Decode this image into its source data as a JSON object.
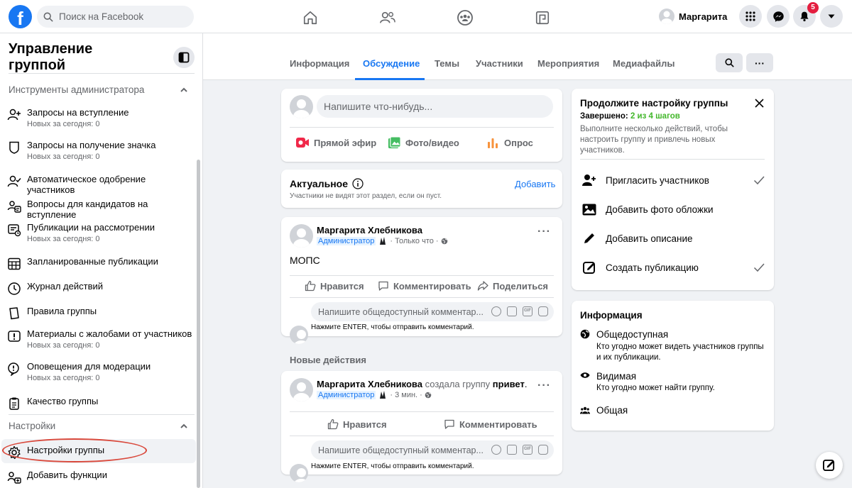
{
  "topbar": {
    "search_placeholder": "Поиск на Facebook",
    "user_name": "Маргарита",
    "notifications_count": "5"
  },
  "sidebar": {
    "title": "Управление группой",
    "admin_tools_label": "Инструменты администратора",
    "items": [
      {
        "label": "Запросы на вступление",
        "sub": "Новых за сегодня: 0",
        "icon": "user-plus-icon"
      },
      {
        "label": "Запросы на получение значка",
        "sub": "Новых за сегодня: 0",
        "icon": "badge-shield-icon"
      },
      {
        "label": "Автоматическое одобрение участников",
        "sub": "",
        "icon": "user-check-icon"
      },
      {
        "label": "Вопросы для кандидатов на вступление",
        "sub": "",
        "icon": "questions-icon"
      },
      {
        "label": "Публикации на рассмотрении",
        "sub": "Новых за сегодня: 0",
        "icon": "pending-posts-icon"
      },
      {
        "label": "Запланированные публикации",
        "sub": "",
        "icon": "calendar-icon"
      },
      {
        "label": "Журнал действий",
        "sub": "",
        "icon": "clock-icon"
      },
      {
        "label": "Правила группы",
        "sub": "",
        "icon": "book-icon"
      },
      {
        "label": "Материалы с жалобами от участников",
        "sub": "Новых за сегодня: 0",
        "icon": "alert-icon"
      },
      {
        "label": "Оповещения для модерации",
        "sub": "Новых за сегодня: 0",
        "icon": "moderation-alert-icon"
      },
      {
        "label": "Качество группы",
        "sub": "",
        "icon": "clipboard-icon"
      }
    ],
    "settings_label": "Настройки",
    "settings_items": [
      {
        "label": "Настройки группы",
        "icon": "gear-icon"
      },
      {
        "label": "Добавить функции",
        "icon": "add-features-icon"
      }
    ]
  },
  "tabs": [
    "Информация",
    "Обсуждение",
    "Темы",
    "Участники",
    "Мероприятия",
    "Медиафайлы"
  ],
  "composer": {
    "placeholder": "Напишите что-нибудь...",
    "live": "Прямой эфир",
    "photo": "Фото/видео",
    "poll": "Опрос"
  },
  "featured": {
    "title": "Актуальное",
    "desc": "Участники не видят этот раздел, если он пуст.",
    "add": "Добавить"
  },
  "post1": {
    "author": "Маргарита Хлебникова",
    "role": "Администратор",
    "time": "· Только что ·",
    "text": "МОПС",
    "like": "Нравится",
    "comment": "Комментировать",
    "share": "Поделиться",
    "comment_placeholder": "Напишите общедоступный комментар...",
    "enter_hint": "Нажмите ENTER, чтобы отправить комментарий."
  },
  "new_activity_label": "Новые действия",
  "post2": {
    "author": "Маргарита Хлебникова",
    "action": "создала группу",
    "group": "привет",
    "dot": ".",
    "role": "Администратор",
    "time": "· 3 мин. ·",
    "like": "Нравится",
    "comment": "Комментировать",
    "comment_placeholder": "Напишите общедоступный комментар...",
    "enter_hint": "Нажмите ENTER, чтобы отправить комментарий."
  },
  "setup": {
    "title": "Продолжите настройку группы",
    "done_label": "Завершено:",
    "done_value": "2 из 4 шагов",
    "desc": "Выполните несколько действий, чтобы настроить группу и привлечь новых участников.",
    "steps": [
      {
        "label": "Пригласить участников",
        "done": true,
        "icon": "invite-icon"
      },
      {
        "label": "Добавить фото обложки",
        "done": false,
        "icon": "photo-icon"
      },
      {
        "label": "Добавить описание",
        "done": false,
        "icon": "pencil-icon"
      },
      {
        "label": "Создать публикацию",
        "done": true,
        "icon": "edit-post-icon"
      }
    ]
  },
  "info": {
    "title": "Информация",
    "public_title": "Общедоступная",
    "public_desc": "Кто угодно может видеть участников группы и их публикации.",
    "visible_title": "Видимая",
    "visible_desc": "Кто угодно может найти группу.",
    "general": "Общая"
  },
  "colors": {
    "accent": "#1877f2",
    "green": "#42b72a",
    "badge": "#e41e3f",
    "annotation": "#d9483b"
  }
}
